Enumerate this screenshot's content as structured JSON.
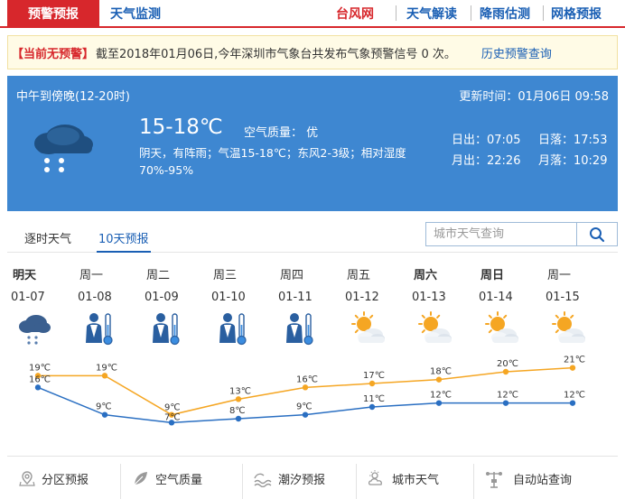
{
  "nav": {
    "active_tab": "预警预报",
    "tab_monitor": "天气监测",
    "tab_typhoon": "台风网",
    "tab_explain": "天气解读",
    "tab_rain": "降雨估测",
    "tab_grid": "网格预报"
  },
  "warning": {
    "tag": "【当前无预警】",
    "message": "截至2018年01月06日,今年深圳市气象台共发布气象预警信号 0 次。",
    "history_link": "历史预警查询"
  },
  "now": {
    "period": "中午到傍晚(12-20时)",
    "update_time": "更新时间：01月06日 09:58",
    "temp_range": "15-18℃",
    "air_quality": "空气质量： 优",
    "description": "阴天，有阵雨；气温15-18℃；东风2-3级；相对湿度70%-95%",
    "sunrise": "日出：07:05",
    "sunset": "日落：17:53",
    "moonrise": "月出：22:26",
    "moonset": "月落：10:29",
    "icon": "cloud-rain-icon"
  },
  "subtabs": {
    "hourly": "逐时天气",
    "tenday": "10天预报",
    "search_placeholder": "城市天气查询"
  },
  "forecast": [
    {
      "day": "明天",
      "date": "01-07",
      "icon": "cloud-rain-icon",
      "bold": true
    },
    {
      "day": "周一",
      "date": "01-08",
      "icon": "cold-person-icon",
      "bold": false
    },
    {
      "day": "周二",
      "date": "01-09",
      "icon": "cold-person-icon",
      "bold": false
    },
    {
      "day": "周三",
      "date": "01-10",
      "icon": "cold-person-icon",
      "bold": false
    },
    {
      "day": "周四",
      "date": "01-11",
      "icon": "cold-person-icon",
      "bold": false
    },
    {
      "day": "周五",
      "date": "01-12",
      "icon": "partly-cloudy-icon",
      "bold": false
    },
    {
      "day": "周六",
      "date": "01-13",
      "icon": "partly-cloudy-icon",
      "bold": true
    },
    {
      "day": "周日",
      "date": "01-14",
      "icon": "partly-cloudy-icon",
      "bold": true
    },
    {
      "day": "周一",
      "date": "01-15",
      "icon": "partly-cloudy-icon",
      "bold": false
    }
  ],
  "chart_data": {
    "type": "line",
    "categories": [
      "01-07",
      "01-08",
      "01-09",
      "01-10",
      "01-11",
      "01-12",
      "01-13",
      "01-14",
      "01-15"
    ],
    "series": [
      {
        "values": [
          19,
          19,
          9,
          13,
          16,
          17,
          18,
          20,
          21
        ],
        "color": "#f5a623"
      },
      {
        "values": [
          16,
          9,
          7,
          8,
          9,
          11,
          12,
          12,
          12
        ],
        "color": "#2a6fc2"
      }
    ],
    "unit": "℃",
    "ylim": [
      5,
      23
    ]
  },
  "bottom": {
    "item1": "分区预报",
    "item2": "空气质量",
    "item3": "潮汐预报",
    "item4": "城市天气",
    "item5": "自动站查询"
  },
  "colors": {
    "brand_red": "#d7272c",
    "panel_blue": "#3e87d1",
    "link_blue": "#1a5fb4"
  }
}
